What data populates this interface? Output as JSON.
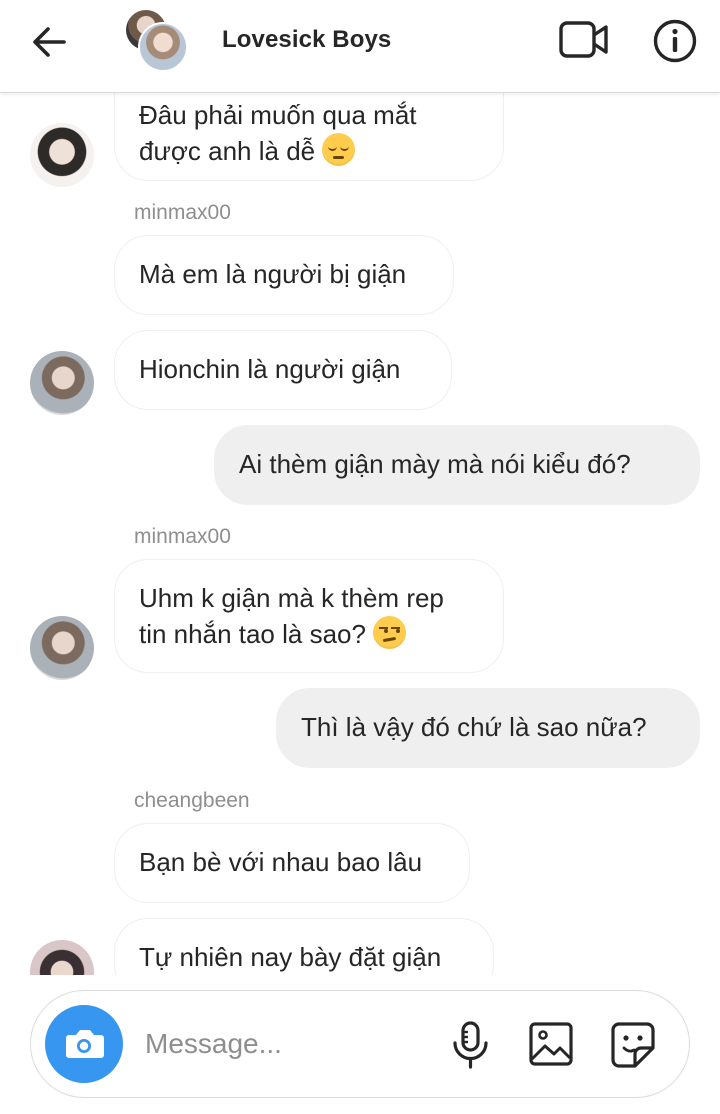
{
  "header": {
    "title": "Lovesick Boys",
    "back_icon": "arrow-left-icon",
    "video_icon": "video-camera-icon",
    "info_icon": "info-icon"
  },
  "messages": [
    {
      "direction": "in",
      "lines": [
        "Đâu phải muốn qua mắt",
        "được anh là dễ"
      ],
      "emoji": "pensive"
    },
    {
      "sender": "minmax00",
      "direction": "in",
      "lines": [
        "Mà em là người bị giận"
      ]
    },
    {
      "direction": "in",
      "lines": [
        "Hionchin là người giận"
      ]
    },
    {
      "direction": "out",
      "lines": [
        "Ai thèm giận mày mà nói kiểu đó?"
      ]
    },
    {
      "sender": "minmax00",
      "direction": "in",
      "lines": [
        "Uhm k giận mà k thèm rep",
        "tin nhắn tao là sao?"
      ],
      "emoji": "unamused"
    },
    {
      "direction": "out",
      "lines": [
        "Thì là vậy đó chứ là sao nữa?"
      ]
    },
    {
      "sender": "cheangbeen",
      "direction": "in",
      "lines": [
        "Bạn bè với nhau bao lâu"
      ]
    },
    {
      "direction": "in",
      "lines": [
        "Tự nhiên nay bày đặt giận"
      ]
    }
  ],
  "composer": {
    "placeholder": "Message...",
    "camera_icon": "camera-icon",
    "mic_icon": "microphone-icon",
    "gallery_icon": "image-gallery-icon",
    "sticker_icon": "sticker-icon"
  },
  "colors": {
    "accent": "#3797f0",
    "outgoing_bubble": "#efefef",
    "incoming_border": "#efefef",
    "secondary_text": "#8e8e8e"
  }
}
